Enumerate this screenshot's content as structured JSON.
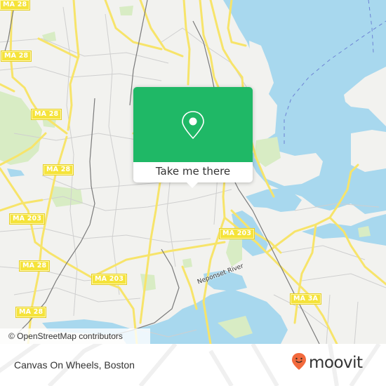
{
  "map": {
    "route_shields": [
      {
        "label": "MA 28"
      },
      {
        "label": "MA 28"
      },
      {
        "label": "MA 28"
      },
      {
        "label": "MA 28"
      },
      {
        "label": "MA 203"
      },
      {
        "label": "MA 28"
      },
      {
        "label": "MA 203"
      },
      {
        "label": "MA 28"
      },
      {
        "label": "MA 203"
      },
      {
        "label": "MA 3A"
      }
    ],
    "water_labels": {
      "neponset": "Neponset River"
    },
    "attribution": "© OpenStreetMap contributors",
    "colors": {
      "land": "#f2f2ef",
      "water": "#a8d8ee",
      "park": "#d8ecc4",
      "road_major": "#f7e46a",
      "road_minor": "#c9c9c9",
      "rail": "#777777"
    }
  },
  "popup": {
    "icon": "map-pin-icon",
    "button_label": "Take me there",
    "color": "#1fb866"
  },
  "footer": {
    "place_name": "Canvas On Wheels, Boston",
    "brand": "moovit",
    "brand_icon": "moovit-smile-pin-icon",
    "brand_color": "#f26a3d"
  }
}
